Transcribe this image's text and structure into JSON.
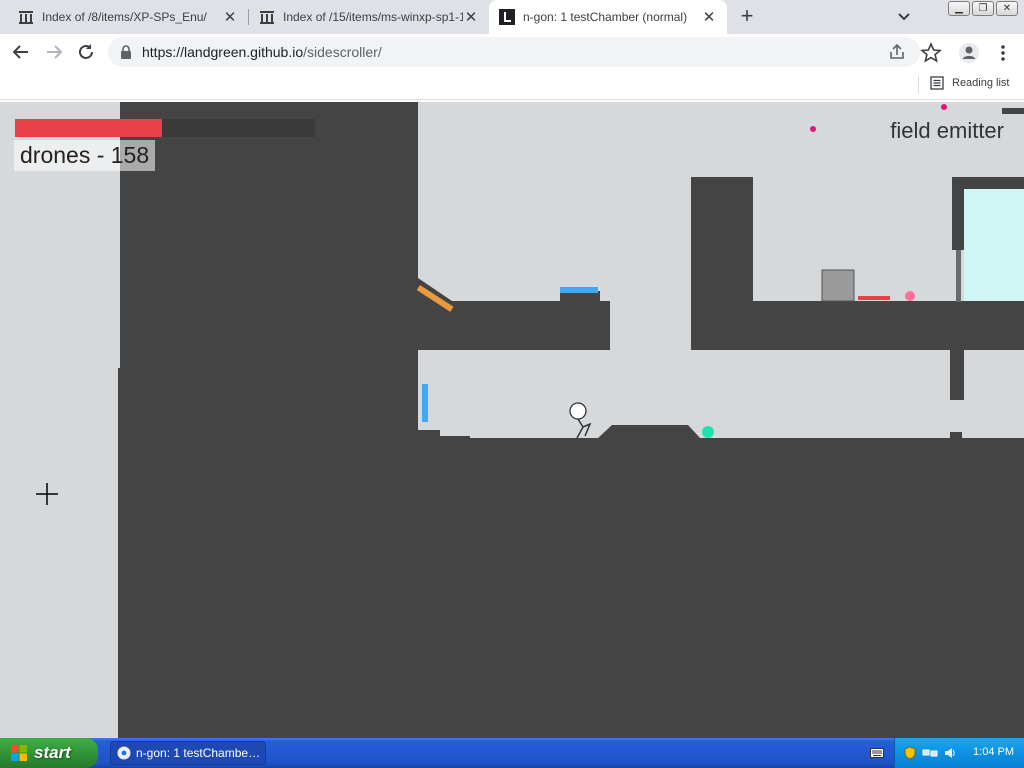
{
  "browser": {
    "tabs": [
      {
        "title": "Index of /8/items/XP-SPs_Enu/",
        "favicon": "archive-icon",
        "active": false
      },
      {
        "title": "Index of /15/items/ms-winxp-sp1-1(",
        "favicon": "archive-icon",
        "active": false
      },
      {
        "title": "n-gon: 1 testChamber (normal)",
        "favicon": "landgreen-icon",
        "active": true
      }
    ],
    "url_host": "https://landgreen.github.io",
    "url_path": "/sidescroller/",
    "reading_list_label": "Reading list"
  },
  "game": {
    "health_fraction": 0.49,
    "mob_label": "drones - 158",
    "field_label": "field emitter",
    "colors": {
      "background": "#d6d9db",
      "map": "#444444",
      "health": "#e84048",
      "block_blue": "#3fa9f5",
      "block_orange": "#e89a3c",
      "powerup_teal": "#1ee3b0",
      "powerup_pink": "#ff6f9a",
      "drone_magenta": "#e0157a",
      "portal_cyan": "#d0f5f5"
    }
  },
  "taskbar": {
    "start_label": "start",
    "task_label": "n-gon: 1 testChambe…",
    "clock": "1:04 PM"
  }
}
